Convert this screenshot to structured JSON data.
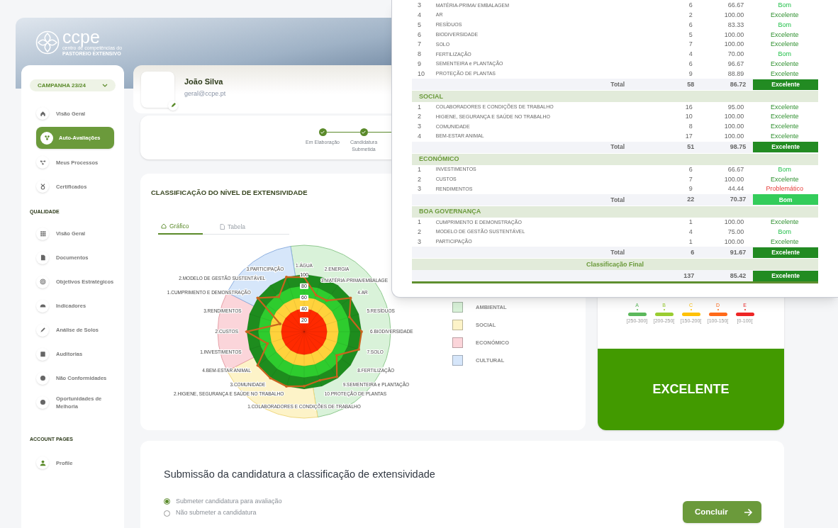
{
  "banner": {
    "logo": "ccpe",
    "tagline_top": "centro de competências do",
    "tagline_bottom": "PASTOREIO EXTENSIVO"
  },
  "sidebar": {
    "campaign": "CAMPANHA 23/24",
    "sections": [
      {
        "items": [
          {
            "label": "Visão Geral",
            "selected": false
          },
          {
            "label": "Auto-Avaliações",
            "selected": true
          },
          {
            "label": "Meus Processos",
            "selected": false
          },
          {
            "label": "Certificados",
            "selected": false
          }
        ]
      },
      {
        "heading": "QUALIDADE",
        "items": [
          {
            "label": "Visão Geral",
            "selected": false
          },
          {
            "label": "Documentos",
            "selected": false
          },
          {
            "label": "Objetivos Estratégicos",
            "selected": false
          },
          {
            "label": "Indicadores",
            "selected": false
          },
          {
            "label": "Análise de Solos",
            "selected": false
          },
          {
            "label": "Auditorias",
            "selected": false
          },
          {
            "label": "Não Conformidades",
            "selected": false
          },
          {
            "label": "Oportunidades de Melhoria",
            "selected": false
          }
        ]
      },
      {
        "heading": "ACCOUNT PAGES",
        "items": [
          {
            "label": "Profile",
            "selected": false
          }
        ]
      }
    ]
  },
  "profile": {
    "name": "João Silva",
    "email": "geral@ccpe.pt"
  },
  "steps": [
    {
      "label": "Em Elaboração",
      "done": true
    },
    {
      "label": "Candidatura Submetida",
      "done": true
    }
  ],
  "chart_card": {
    "title": "CLASSIFICAÇÃO DO NÍVEL DE EXTENSIVIDADE",
    "tabs": [
      {
        "label": "Gráfico",
        "selected": true
      },
      {
        "label": "Tabela",
        "selected": false
      }
    ],
    "radar_chart": {
      "right_labels": [
        "1.ÁGUA",
        "2.ENERGIA",
        "3.MATÉRIA-PRIMA/EMBALAGE",
        "4.AR",
        "5.RESÍDUOS",
        "6.BIODIVERSIDADE",
        "7.SOLO",
        "8.FERTILIZAÇÃO",
        "9.SEMENTEIRA e PLANTAÇÃO",
        "10.PROTEÇÃO DE PLANTAS",
        "1.COLABORADORES E CONDIÇÕES DE TRABALHO"
      ],
      "left_labels": [
        "3.PARTICIPAÇÃO",
        "2.MODELO DE GESTÃO SUSTENTÁVEL",
        "1.CUMPRIMENTO E DEMONSTRAÇÃO",
        "3.RENDIMENTOS",
        "2.CUSTOS",
        "1.INVESTIMENTOS",
        "4.BEM-ESTAR ANIMAL",
        "3.COMUNIDADE",
        "2.HIGIENE, SEGURANÇA E SAÚDE NO TRABALHO"
      ],
      "scale_labels": [
        "100",
        "80",
        "60",
        "40",
        "20"
      ]
    },
    "legend": [
      {
        "label": "AMBIENTAL",
        "color": "#d9f2d9"
      },
      {
        "label": "SOCIAL",
        "color": "#fdf3c8"
      },
      {
        "label": "ECONÓMICO",
        "color": "#fbd5da"
      },
      {
        "label": "CULTURAL",
        "color": "#d6e6fa"
      }
    ]
  },
  "grade_card": {
    "scale": [
      {
        "letter": "A",
        "range": "[250-300]",
        "color": "#5cb85c"
      },
      {
        "letter": "B",
        "range": "[200-250[",
        "color": "#9acd32"
      },
      {
        "letter": "C",
        "range": "[150-200[",
        "color": "#ffc107"
      },
      {
        "letter": "D",
        "range": "[100-150[",
        "color": "#ff6a1a"
      },
      {
        "letter": "E",
        "range": "[0-100[",
        "color": "#ee2626"
      }
    ],
    "result": "EXCELENTE"
  },
  "submission": {
    "title": "Submissão da candidatura a classificação de extensividade",
    "options": [
      {
        "label": "Submeter candidatura para avaliação",
        "selected": true
      },
      {
        "label": "Não submeter a candidatura",
        "selected": false
      }
    ],
    "button": "Concluir"
  },
  "results_table": {
    "groups": [
      {
        "rows": [
          {
            "number": "3",
            "name": "MATÉRIA-PRIMA/ EMBALAGEM",
            "count": "6",
            "score": "66.67",
            "rating": "Bom",
            "kind": "good"
          },
          {
            "number": "4",
            "name": "AR",
            "count": "2",
            "score": "100.00",
            "rating": "Excelente",
            "kind": "excellent"
          },
          {
            "number": "5",
            "name": "RESÍDUOS",
            "count": "6",
            "score": "83.33",
            "rating": "Bom",
            "kind": "good"
          },
          {
            "number": "6",
            "name": "BIODIVERSIDADE",
            "count": "5",
            "score": "100.00",
            "rating": "Excelente",
            "kind": "excellent"
          },
          {
            "number": "7",
            "name": "SOLO",
            "count": "7",
            "score": "100.00",
            "rating": "Excelente",
            "kind": "excellent"
          },
          {
            "number": "8",
            "name": "FERTILIZAÇÃO",
            "count": "4",
            "score": "70.00",
            "rating": "Bom",
            "kind": "good"
          },
          {
            "number": "9",
            "name": "SEMENTEIRA e PLANTAÇÃO",
            "count": "6",
            "score": "96.67",
            "rating": "Excelente",
            "kind": "excellent"
          },
          {
            "number": "10",
            "name": "PROTEÇÃO DE PLANTAS",
            "count": "9",
            "score": "88.89",
            "rating": "Excelente",
            "kind": "excellent"
          }
        ],
        "total": {
          "label": "Total",
          "count": "58",
          "score": "86.72",
          "rating": "Excelente",
          "kind": "excellent"
        }
      },
      {
        "name": "SOCIAL",
        "rows": [
          {
            "number": "1",
            "name": "COLABORADORES E CONDIÇÕES DE TRABALHO",
            "count": "16",
            "score": "95.00",
            "rating": "Excelente",
            "kind": "excellent"
          },
          {
            "number": "2",
            "name": "HIGIENE, SEGURANÇA E SAÚDE NO TRABALHO",
            "count": "10",
            "score": "100.00",
            "rating": "Excelente",
            "kind": "excellent"
          },
          {
            "number": "3",
            "name": "COMUNIDADE",
            "count": "8",
            "score": "100.00",
            "rating": "Excelente",
            "kind": "excellent"
          },
          {
            "number": "4",
            "name": "BEM-ESTAR ANIMAL",
            "count": "17",
            "score": "100.00",
            "rating": "Excelente",
            "kind": "excellent"
          }
        ],
        "total": {
          "label": "Total",
          "count": "51",
          "score": "98.75",
          "rating": "Excelente",
          "kind": "excellent"
        }
      },
      {
        "name": "ECONÓMICO",
        "rows": [
          {
            "number": "1",
            "name": "INVESTIMENTOS",
            "count": "6",
            "score": "66.67",
            "rating": "Bom",
            "kind": "good"
          },
          {
            "number": "2",
            "name": "CUSTOS",
            "count": "7",
            "score": "100.00",
            "rating": "Excelente",
            "kind": "excellent"
          },
          {
            "number": "3",
            "name": "RENDIMENTOS",
            "count": "9",
            "score": "44.44",
            "rating": "Problemático",
            "kind": "problem"
          }
        ],
        "total": {
          "label": "Total",
          "count": "22",
          "score": "70.37",
          "rating": "Bom",
          "kind": "good"
        }
      },
      {
        "name": "BOA GOVERNANÇA",
        "rows": [
          {
            "number": "1",
            "name": "CUMPRIMENTO E DEMONSTRAÇÃO",
            "count": "1",
            "score": "100.00",
            "rating": "Excelente",
            "kind": "excellent"
          },
          {
            "number": "2",
            "name": "MODELO DE GESTÃO SUSTENTÁVEL",
            "count": "4",
            "score": "75.00",
            "rating": "Bom",
            "kind": "good"
          },
          {
            "number": "3",
            "name": "PARTICIPAÇÃO",
            "count": "1",
            "score": "100.00",
            "rating": "Excelente",
            "kind": "excellent"
          }
        ],
        "total": {
          "label": "Total",
          "count": "6",
          "score": "91.67",
          "rating": "Excelente",
          "kind": "excellent"
        }
      }
    ],
    "final": {
      "label": "Classificação Final",
      "count": "137",
      "score": "85.42",
      "rating": "Excelente",
      "kind": "excellent"
    }
  }
}
